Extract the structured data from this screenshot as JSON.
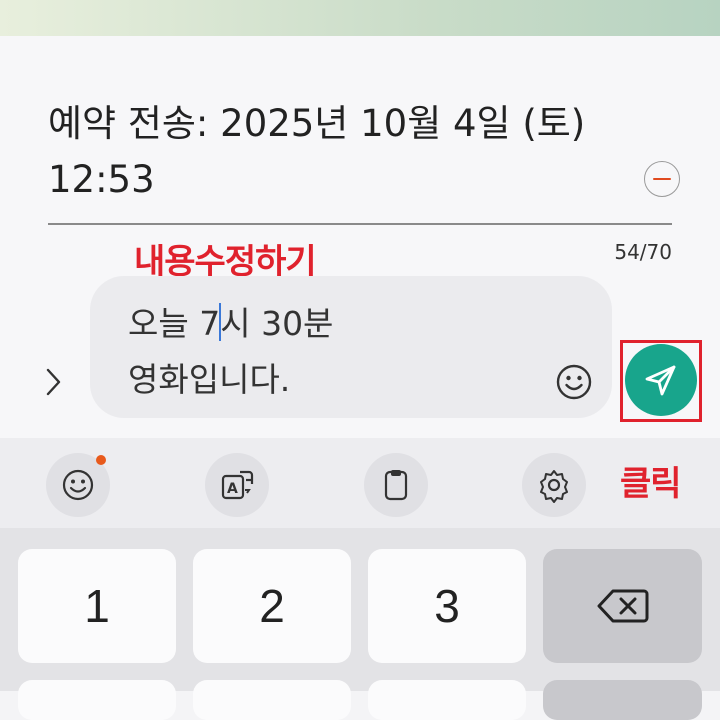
{
  "schedule": {
    "line1": "예약 전송: 2025년 10월 4일 (토)",
    "line2": "12:53"
  },
  "annotations": {
    "edit_label": "내용수정하기",
    "click_label": "클릭"
  },
  "counter": "54/70",
  "message": {
    "line1_before": "오늘 7",
    "line1_after": "시 30분",
    "line2": "영화입니다."
  },
  "icons": {
    "remove": "minus-circle-icon",
    "expand": "chevron-right-icon",
    "emoji": "smiley-icon",
    "send": "paper-plane-icon",
    "translate": "translate-icon",
    "clipboard": "clipboard-icon",
    "settings": "gear-icon",
    "backspace": "backspace-icon"
  },
  "colors": {
    "send": "#18a58c",
    "annotation": "#e0222d",
    "remove": "#e04a1f",
    "caret": "#3a78d8",
    "notif_dot": "#e85a1c"
  },
  "keyboard": {
    "keys": [
      "1",
      "2",
      "3"
    ]
  }
}
